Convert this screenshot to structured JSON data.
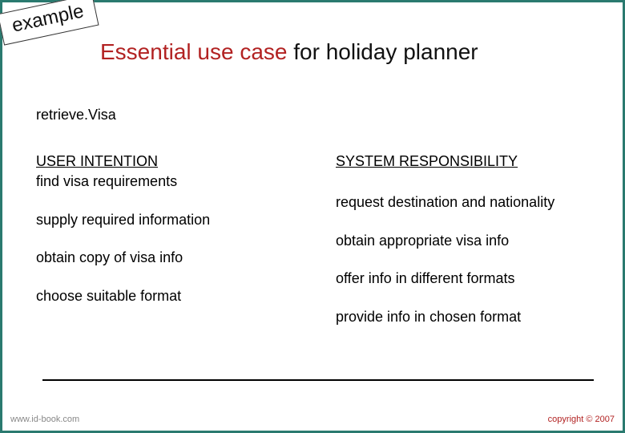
{
  "badge": "example",
  "title_accent": "Essential use case",
  "title_rest": " for holiday planner",
  "usecase_name": "retrieve.Visa",
  "left": {
    "header": "USER INTENTION",
    "steps": [
      "find visa requirements",
      "supply required information",
      "obtain copy of visa info",
      "choose suitable format"
    ]
  },
  "right": {
    "header": "SYSTEM RESPONSIBILITY",
    "steps": [
      "request destination and nationality",
      "obtain appropriate visa info",
      "offer info in different formats",
      "provide info in chosen format"
    ]
  },
  "footer": {
    "left": "www.id-book.com",
    "right": "copyright © 2007"
  }
}
